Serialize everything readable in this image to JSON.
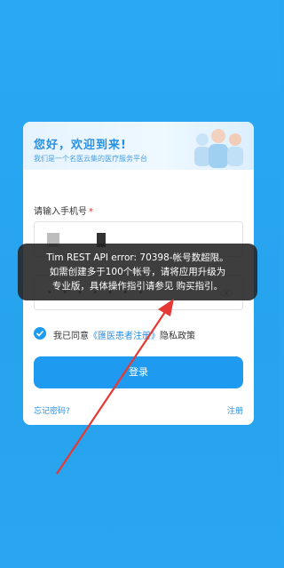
{
  "login": {
    "greeting": "您好，欢迎到来!",
    "subtitle": "我们是一个名医云集的医疗服务平台",
    "phone_label": "请输入手机号",
    "required_mark": "*",
    "password_mask": "• • • • • • •",
    "agree_prefix": "我已同意",
    "agree_link": "《匯医患者注册》",
    "privacy_policy": "隐私政策",
    "login_button": "登录",
    "forgot_password": "忘记密码?",
    "register": "注册"
  },
  "toast": {
    "line1": "Tim REST API error: 70398-帐号数超限。",
    "line2": "如需创建多于100个帐号，请将应用升级为",
    "line3": "专业版，具体操作指引请参见 购买指引。"
  },
  "colors": {
    "background": "#29a6f1",
    "accent": "#2a8fe0",
    "button": "#1e9bf0",
    "annotation": "#e53935"
  }
}
